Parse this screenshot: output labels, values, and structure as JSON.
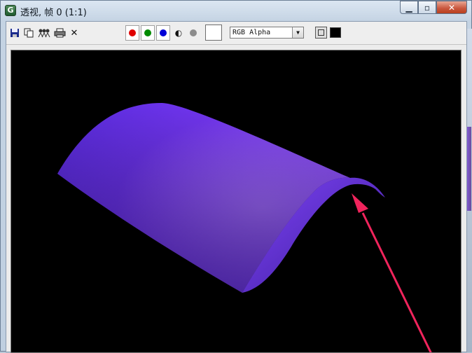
{
  "window": {
    "title": "透视, 帧 0 (1:1)",
    "app_icon_letter": "G",
    "minimize_glyph": "▁",
    "maximize_glyph": "▫",
    "close_glyph": "✕"
  },
  "toolbar": {
    "icons": [
      "save-icon",
      "copy-icon",
      "clone-icon",
      "print-icon",
      "clear-icon"
    ],
    "clear_glyph": "✕",
    "channels": [
      {
        "name": "red-channel",
        "color": "#e00000"
      },
      {
        "name": "green-channel",
        "color": "#008a00"
      },
      {
        "name": "blue-channel",
        "color": "#0000d8"
      }
    ],
    "mono_glyph": "◐",
    "alpha_color": "#8c8c8c",
    "channel_display": "RGB Alpha",
    "dropdown_arrow": "▼"
  },
  "render": {
    "background": "#000000",
    "object_color": "#6a2ee8",
    "arrow_color": "#f0245c"
  }
}
